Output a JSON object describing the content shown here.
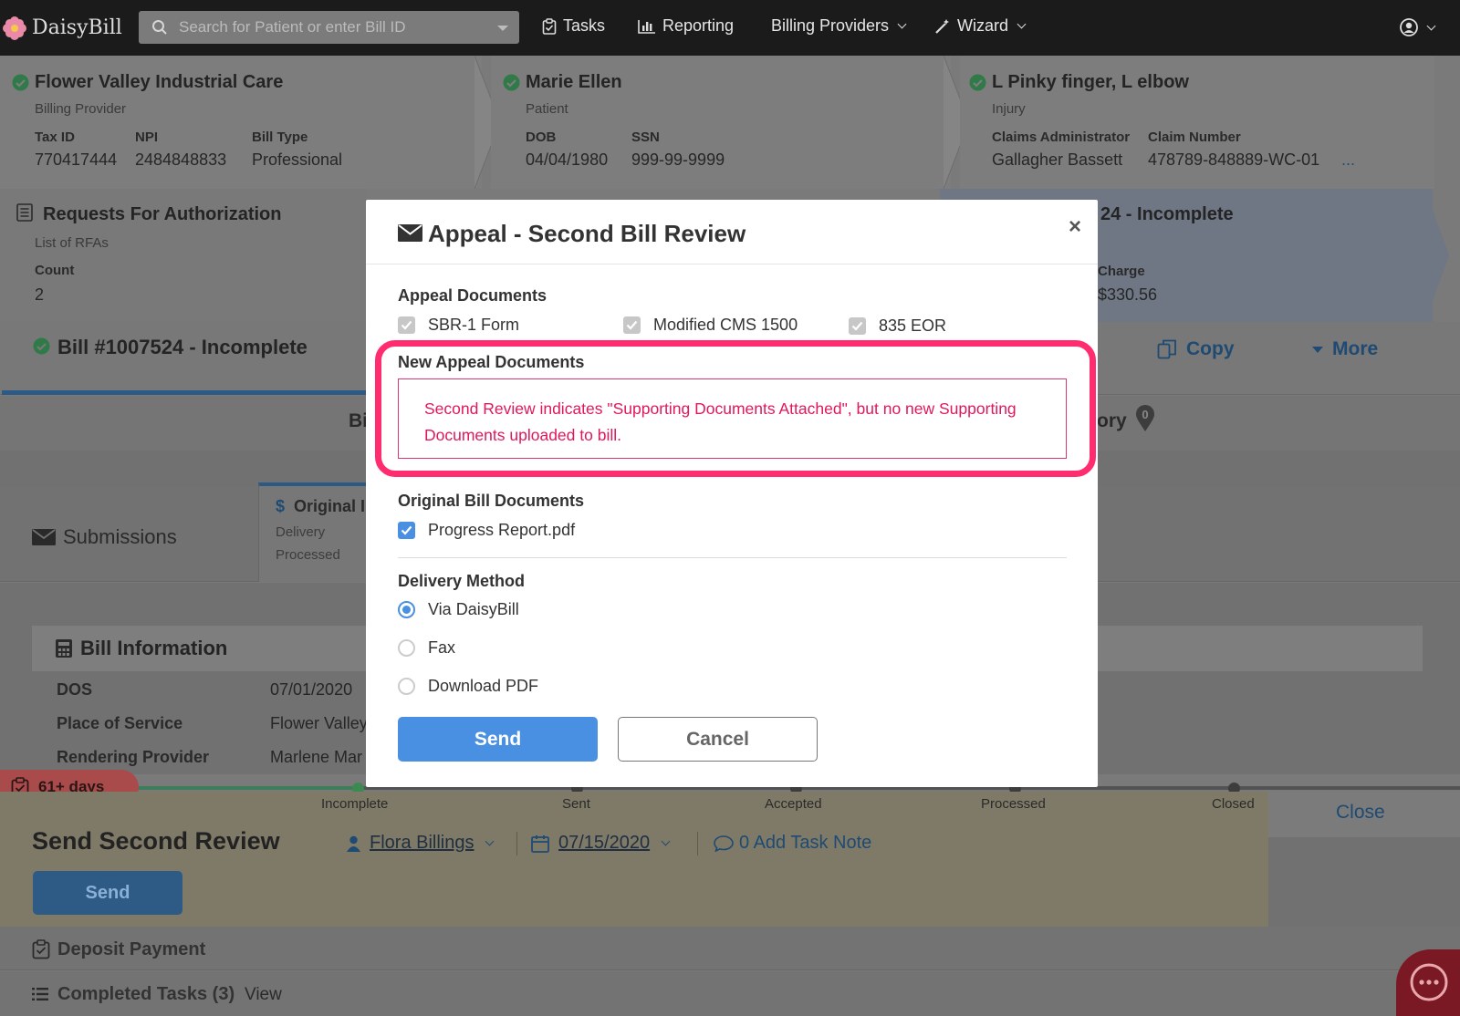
{
  "nav": {
    "brand": "DaisyBill",
    "search_placeholder": "Search for Patient or enter Bill ID",
    "tasks": "Tasks",
    "reporting": "Reporting",
    "billing_providers": "Billing Providers",
    "wizard": "Wizard"
  },
  "provider": {
    "title": "Flower Valley Industrial Care",
    "subtitle": "Billing Provider",
    "fields": [
      {
        "k": "Tax ID",
        "v": "770417444"
      },
      {
        "k": "NPI",
        "v": "2484848833"
      },
      {
        "k": "Bill Type",
        "v": "Professional"
      }
    ]
  },
  "patient": {
    "title": "Marie Ellen",
    "subtitle": "Patient",
    "fields": [
      {
        "k": "DOB",
        "v": "04/04/1980"
      },
      {
        "k": "SSN",
        "v": "999-99-9999"
      }
    ]
  },
  "injury": {
    "title": "L Pinky finger, L elbow",
    "subtitle": "Injury",
    "fields": [
      {
        "k": "Claims Administrator",
        "v": "Gallagher Bassett"
      },
      {
        "k": "Claim Number",
        "v": "478789-848889-WC-01"
      }
    ],
    "more": "..."
  },
  "rfa": {
    "title": "Requests For Authorization",
    "subtitle": "List of RFAs",
    "count_label": "Count",
    "count_value": "2"
  },
  "bill_summary": {
    "title_fragment": "24 - Incomplete",
    "charge_label": "Charge",
    "charge_value": "$330.56"
  },
  "bill_bar": {
    "title": "Bill #1007524 - Incomplete",
    "copy": "Copy",
    "more": "More",
    "tab_fragment": "Bi",
    "history_fragment": "ory",
    "history_count": "0"
  },
  "submissions": {
    "label": "Submissions",
    "original_title": "Original I",
    "delivery": "Delivery",
    "processed": "Processed"
  },
  "bill_info": {
    "title": "Bill Information",
    "rows": [
      {
        "k": "DOS",
        "v": "07/01/2020"
      },
      {
        "k": "Place of Service",
        "v": "Flower Valley"
      },
      {
        "k": "Rendering Provider",
        "v": "Marlene Mar"
      }
    ]
  },
  "modal": {
    "title": "Appeal - Second Bill Review",
    "close": "×",
    "appeal_docs_label": "Appeal Documents",
    "appeal_docs": [
      "SBR-1 Form",
      "Modified CMS 1500",
      "835 EOR"
    ],
    "new_docs_label": "New Appeal Documents",
    "warning": "Second Review indicates \"Supporting Documents Attached\", but no new Supporting Documents uploaded to bill.",
    "original_docs_label": "Original Bill Documents",
    "original_docs": [
      "Progress Report.pdf"
    ],
    "delivery_label": "Delivery Method",
    "delivery_options": [
      "Via DaisyBill",
      "Fax",
      "Download PDF"
    ],
    "selected_delivery": "Via DaisyBill",
    "send": "Send",
    "cancel": "Cancel"
  },
  "workflow": {
    "days": "61+ days",
    "stages": [
      "Incomplete",
      "Sent",
      "Accepted",
      "Processed",
      "Closed"
    ],
    "close": "Close"
  },
  "task": {
    "title": "Send Second Review",
    "assignee": "Flora Billings",
    "date": "07/15/2020",
    "note": "0 Add Task Note",
    "send": "Send"
  },
  "lower": {
    "deposit": "Deposit Payment",
    "completed": "Completed Tasks (3)",
    "view": "View"
  },
  "colors": {
    "accent": "#4a90e2",
    "warning": "#e0185b",
    "highlight": "#ff2d6f",
    "success": "#3c8a52"
  }
}
